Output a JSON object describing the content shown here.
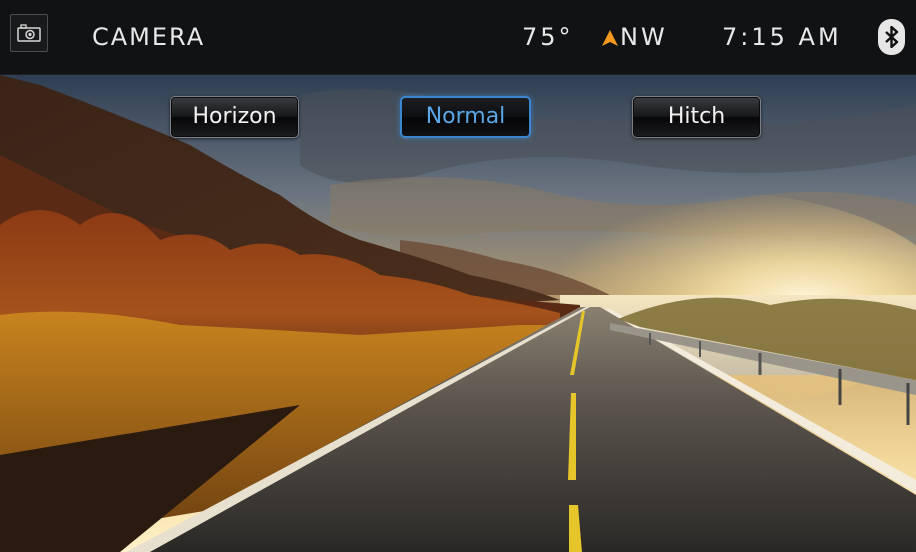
{
  "header": {
    "title": "CAMERA",
    "temperature": "75°",
    "heading": "NW",
    "time": "7:15 AM",
    "icons": {
      "camera": "camera-icon",
      "compass": "compass-arrow-icon",
      "bluetooth": "bluetooth-icon"
    },
    "accent_color": "#f39a1e"
  },
  "camera_view": {
    "modes": [
      {
        "label": "Horizon",
        "active": false
      },
      {
        "label": "Normal",
        "active": true
      },
      {
        "label": "Hitch",
        "active": false
      }
    ],
    "active_color": "#3c86d0"
  }
}
